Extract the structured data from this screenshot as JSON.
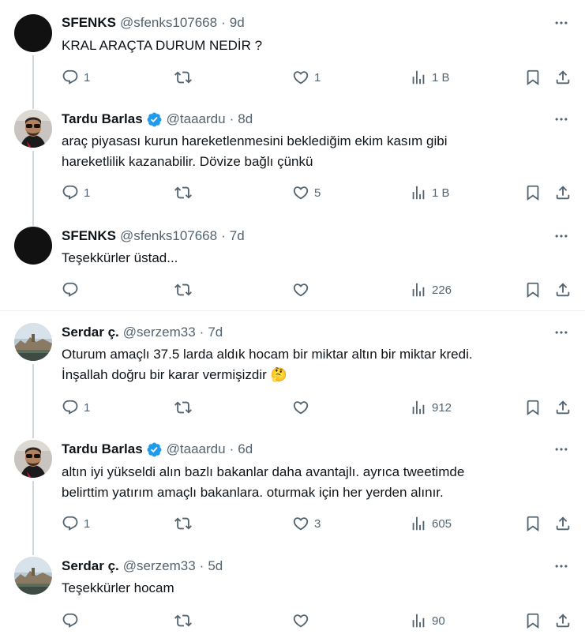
{
  "tweets": [
    {
      "name": "SFENKS",
      "handle": "@sfenks107668",
      "separator": "·",
      "time": "9d",
      "text": "KRAL ARAÇTA DURUM NEDİR ?",
      "verified": false,
      "avatar": "black",
      "replies": "1",
      "retweets": "",
      "likes": "1",
      "views": "1 B"
    },
    {
      "name": "Tardu Barlas",
      "handle": "@taaardu",
      "separator": "·",
      "time": "8d",
      "text_lines": [
        "araç piyasası kurun hareketlenmesini beklediğim ekim kasım gibi",
        "hareketlilik kazanabilir. Dövize bağlı çünkü"
      ],
      "verified": true,
      "avatar": "man-sunglasses",
      "replies": "1",
      "retweets": "",
      "likes": "5",
      "views": "1 B"
    },
    {
      "name": "SFENKS",
      "handle": "@sfenks107668",
      "separator": "·",
      "time": "7d",
      "text": "Teşekkürler üstad...",
      "verified": false,
      "avatar": "black",
      "replies": "",
      "retweets": "",
      "likes": "",
      "views": "226"
    },
    {
      "name": "Serdar ç.",
      "handle": "@serzem33",
      "separator": "·",
      "time": "7d",
      "text_lines": [
        "Oturum amaçlı 37.5 larda aldık hocam bir miktar altın bir miktar kredi.",
        "İnşallah doğru bir karar vermişizdir 🤔"
      ],
      "verified": false,
      "avatar": "landscape",
      "replies": "1",
      "retweets": "",
      "likes": "",
      "views": "912"
    },
    {
      "name": "Tardu Barlas",
      "handle": "@taaardu",
      "separator": "·",
      "time": "6d",
      "text_lines": [
        "altın iyi yükseldi alın bazlı bakanlar daha avantajlı. ayrıca  tweetimde",
        "belirttim yatırım amaçlı bakanlara. oturmak için her yerden alınır."
      ],
      "verified": true,
      "avatar": "man-sunglasses",
      "replies": "1",
      "retweets": "",
      "likes": "3",
      "views": "605"
    },
    {
      "name": "Serdar ç.",
      "handle": "@serzem33",
      "separator": "·",
      "time": "5d",
      "text": "Teşekkürler hocam",
      "verified": false,
      "avatar": "landscape",
      "replies": "",
      "retweets": "",
      "likes": "",
      "views": "90"
    }
  ],
  "icons": {
    "reply": "reply-icon",
    "retweet": "retweet-icon",
    "like": "heart-icon",
    "views": "views-chart-icon",
    "bookmark": "bookmark-icon",
    "share": "share-icon",
    "more": "more-dots-icon",
    "verified": "verified-badge-icon"
  },
  "colors": {
    "text": "#0f1419",
    "secondary": "#536471",
    "verified": "#1d9bf0",
    "thread_line": "#cfd9de",
    "divider": "#eff3f4"
  }
}
